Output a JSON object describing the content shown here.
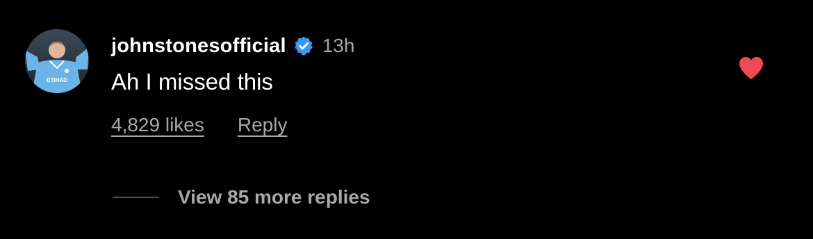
{
  "comment": {
    "username": "johnstonesofficial",
    "timestamp": "13h",
    "text": "Ah I missed this",
    "likes_label": "4,829 likes",
    "reply_label": "Reply",
    "liked": true,
    "verified": true
  },
  "replies": {
    "label": "View 85 more replies"
  },
  "avatar": {
    "jersey_text": "ETIHAD"
  },
  "colors": {
    "background": "#000000",
    "primary_text": "#ffffff",
    "secondary_text": "#a8a8a8",
    "verified_blue": "#3897f0",
    "heart_red": "#ed4956"
  },
  "icons": {
    "verified": "verified-badge-icon",
    "like": "heart-filled-icon"
  }
}
